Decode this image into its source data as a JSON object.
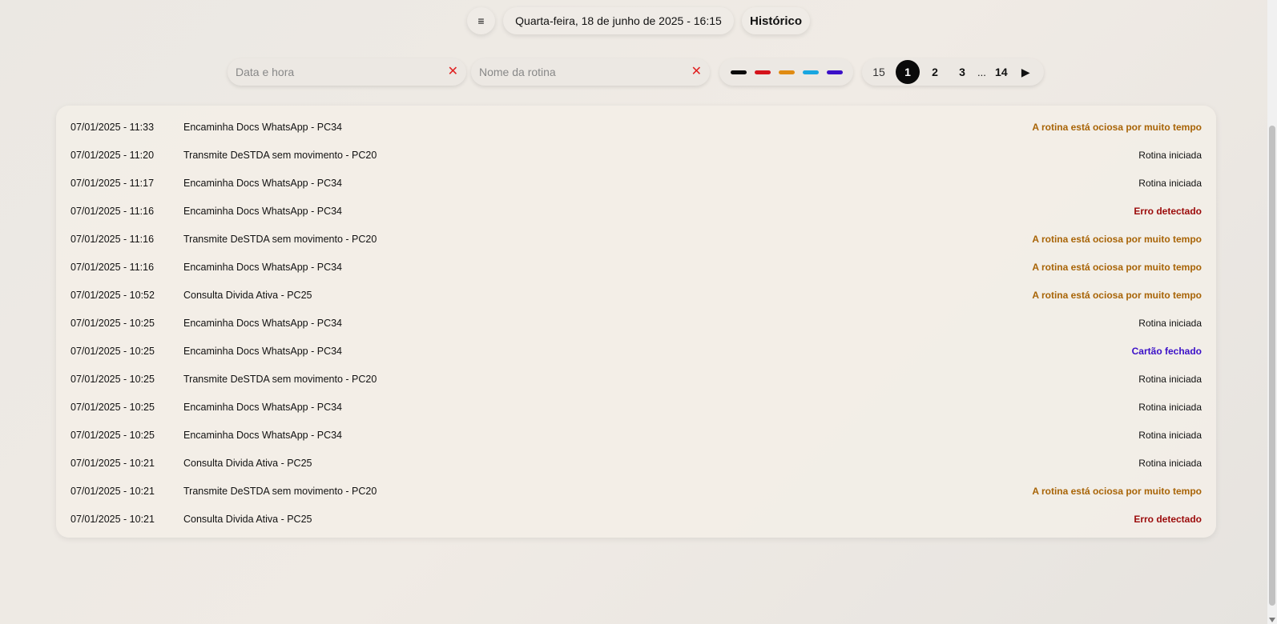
{
  "header": {
    "menu_icon": "hamburger-icon",
    "menu_glyph": "≡",
    "datetime": "Quarta-feira, 18 de junho de 2025 - 16:15",
    "history_label": "Histórico"
  },
  "filters": {
    "date_placeholder": "Data e hora",
    "routine_placeholder": "Nome da rotina",
    "clear_glyph": "✕",
    "colors": [
      "#0a0a0a",
      "#d4131b",
      "#e08b12",
      "#19a6e0",
      "#3b10c8"
    ]
  },
  "pagination": {
    "per_page": "15",
    "pages": [
      "1",
      "2",
      "3"
    ],
    "current": "1",
    "ellipsis": "...",
    "last": "14",
    "next_glyph": "▶"
  },
  "status_colors": {
    "ociosa": "#a86407",
    "erro": "#9b0a0a",
    "fechado": "#3b10c8",
    "iniciada": "#111111"
  },
  "rows": [
    {
      "time": "07/01/2025 - 11:33",
      "name": "Encaminha Docs WhatsApp - PC34",
      "status": "A rotina está ociosa por muito tempo",
      "kind": "ociosa"
    },
    {
      "time": "07/01/2025 - 11:20",
      "name": "Transmite DeSTDA sem movimento - PC20",
      "status": "Rotina iniciada",
      "kind": "iniciada"
    },
    {
      "time": "07/01/2025 - 11:17",
      "name": "Encaminha Docs WhatsApp - PC34",
      "status": "Rotina iniciada",
      "kind": "iniciada"
    },
    {
      "time": "07/01/2025 - 11:16",
      "name": "Encaminha Docs WhatsApp - PC34",
      "status": "Erro detectado",
      "kind": "erro"
    },
    {
      "time": "07/01/2025 - 11:16",
      "name": "Transmite DeSTDA sem movimento - PC20",
      "status": "A rotina está ociosa por muito tempo",
      "kind": "ociosa"
    },
    {
      "time": "07/01/2025 - 11:16",
      "name": "Encaminha Docs WhatsApp - PC34",
      "status": "A rotina está ociosa por muito tempo",
      "kind": "ociosa"
    },
    {
      "time": "07/01/2025 - 10:52",
      "name": "Consulta Divida Ativa - PC25",
      "status": "A rotina está ociosa por muito tempo",
      "kind": "ociosa"
    },
    {
      "time": "07/01/2025 - 10:25",
      "name": "Encaminha Docs WhatsApp - PC34",
      "status": "Rotina iniciada",
      "kind": "iniciada"
    },
    {
      "time": "07/01/2025 - 10:25",
      "name": "Encaminha Docs WhatsApp - PC34",
      "status": "Cartão fechado",
      "kind": "fechado"
    },
    {
      "time": "07/01/2025 - 10:25",
      "name": "Transmite DeSTDA sem movimento - PC20",
      "status": "Rotina iniciada",
      "kind": "iniciada"
    },
    {
      "time": "07/01/2025 - 10:25",
      "name": "Encaminha Docs WhatsApp - PC34",
      "status": "Rotina iniciada",
      "kind": "iniciada"
    },
    {
      "time": "07/01/2025 - 10:25",
      "name": "Encaminha Docs WhatsApp - PC34",
      "status": "Rotina iniciada",
      "kind": "iniciada"
    },
    {
      "time": "07/01/2025 - 10:21",
      "name": "Consulta Divida Ativa - PC25",
      "status": "Rotina iniciada",
      "kind": "iniciada"
    },
    {
      "time": "07/01/2025 - 10:21",
      "name": "Transmite DeSTDA sem movimento - PC20",
      "status": "A rotina está ociosa por muito tempo",
      "kind": "ociosa"
    },
    {
      "time": "07/01/2025 - 10:21",
      "name": "Consulta Divida Ativa - PC25",
      "status": "Erro detectado",
      "kind": "erro"
    }
  ]
}
